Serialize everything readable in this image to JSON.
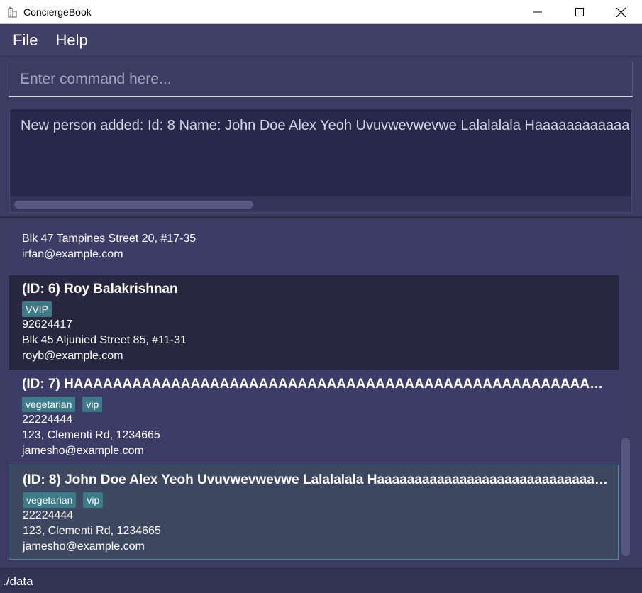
{
  "window": {
    "title": "ConciergeBook",
    "icon": "building-icon",
    "controls": [
      "minimize-icon",
      "maximize-icon",
      "close-icon"
    ]
  },
  "menu": {
    "items": [
      "File",
      "Help"
    ]
  },
  "command": {
    "placeholder": "Enter command here...",
    "value": ""
  },
  "result": {
    "text": "New person added: Id: 8 Name: John Doe Alex Yeoh Uvuvwevwevwe Lalalalala Haaaaaaaaaaaa"
  },
  "persons": [
    {
      "name": "",
      "tags": [],
      "phone": "",
      "address": "Blk 47 Tampines Street 20, #17-35",
      "email": "irfan@example.com"
    },
    {
      "name": "(ID: 6) Roy Balakrishnan",
      "tags": [
        "VVIP"
      ],
      "phone": "92624417",
      "address": "Blk 45 Aljunied Street 85, #11-31",
      "email": "royb@example.com"
    },
    {
      "name": "(ID: 7) HAAAAAAAAAAAAAAAAAAAAAAAAAAAAAAAAAAAAAAAAAAAAAAAAAAAAAAAAAAA...",
      "tags": [
        "vegetarian",
        "vip"
      ],
      "phone": "22224444",
      "address": "123, Clementi Rd, 1234665",
      "email": "jamesho@example.com"
    },
    {
      "name": "(ID: 8) John Doe Alex Yeoh Uvuvwevwevwe Lalalalala Haaaaaaaaaaaaaaaaaaaaaaaaaaaaaaa...",
      "tags": [
        "vegetarian",
        "vip"
      ],
      "phone": "22224444",
      "address": "123, Clementi Rd, 1234665",
      "email": "jamesho@example.com"
    }
  ],
  "status": {
    "path": "./data"
  }
}
